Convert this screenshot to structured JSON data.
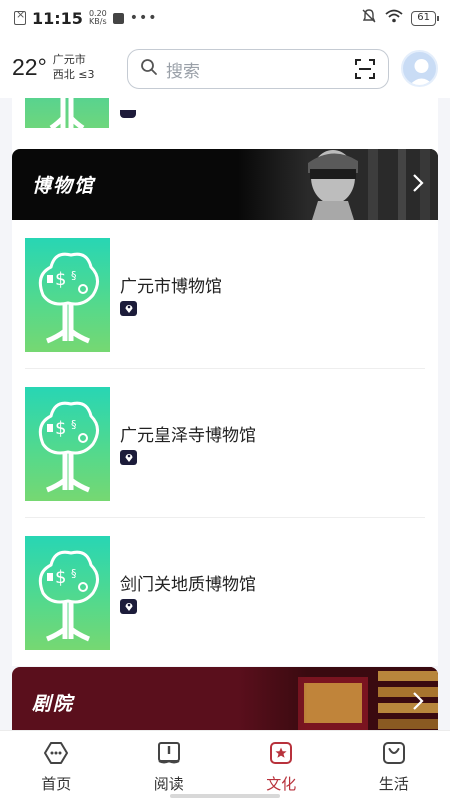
{
  "status_bar": {
    "time": "11:15",
    "net_speed_value": "0.20",
    "net_speed_unit": "KB/s",
    "battery": "61",
    "icons": [
      "sim-icon",
      "app-notification-icon",
      "more-dots-icon",
      "mute-icon",
      "wifi-icon",
      "battery-icon"
    ]
  },
  "header": {
    "temperature": "22°",
    "city": "广元市",
    "wind": "西北 ≤3",
    "search_placeholder": "搜索"
  },
  "sections": {
    "museum": {
      "title": "博物馆"
    },
    "theatre": {
      "title": "剧院"
    }
  },
  "museums": [
    {
      "name": "广元市博物馆"
    },
    {
      "name": "广元皇泽寺博物馆"
    },
    {
      "name": "剑门关地质博物馆"
    }
  ],
  "nav": {
    "items": [
      {
        "label": "首页",
        "icon": "home-icon"
      },
      {
        "label": "阅读",
        "icon": "book-icon"
      },
      {
        "label": "文化",
        "icon": "culture-star-icon"
      },
      {
        "label": "生活",
        "icon": "bag-icon"
      }
    ],
    "active_index": 2,
    "active_color": "#b8323c"
  }
}
